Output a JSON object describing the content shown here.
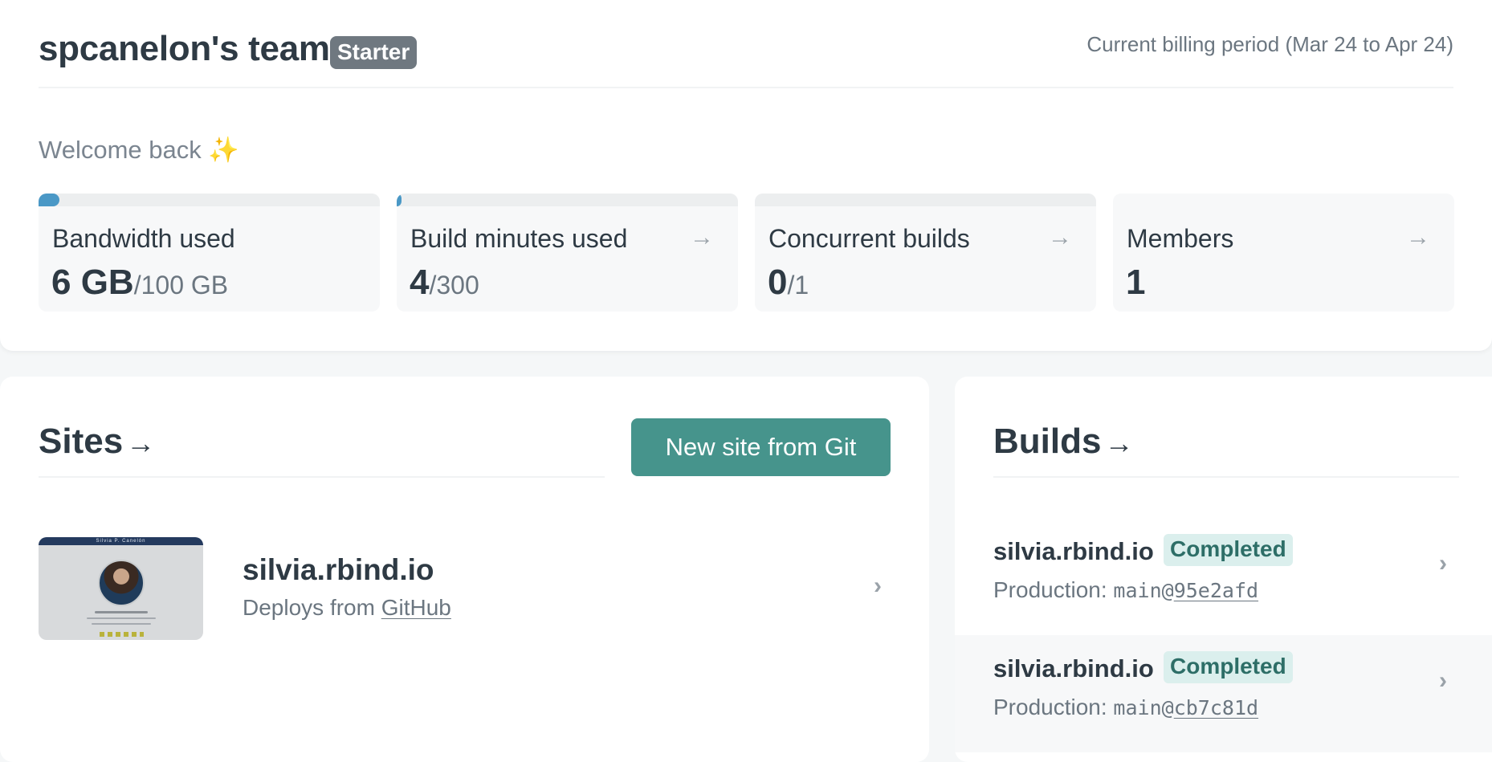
{
  "team": {
    "name": "spcanelon's team",
    "plan": "Starter",
    "billing_period": "Current billing period (Mar 24 to Apr 24)"
  },
  "welcome": {
    "text": "Welcome back",
    "emoji": "✨"
  },
  "stats": [
    {
      "label": "Bandwidth used",
      "value": "6 GB",
      "limit": "/100 GB",
      "progress_fraction": 0.06,
      "has_arrow": false
    },
    {
      "label": "Build minutes used",
      "value": "4",
      "limit": "/300",
      "progress_fraction": 0.013,
      "has_arrow": true
    },
    {
      "label": "Concurrent builds",
      "value": "0",
      "limit": "/1",
      "progress_fraction": 0.0,
      "has_arrow": true
    },
    {
      "label": "Members",
      "value": "1",
      "limit": "",
      "progress_fraction": null,
      "has_arrow": true
    }
  ],
  "arrow_glyph": "→",
  "sites": {
    "title": "Sites",
    "title_arrow": "→",
    "new_button": "New site from Git",
    "items": [
      {
        "name": "silvia.rbind.io",
        "deploys_prefix": "Deploys from",
        "deploys_source": "GitHub",
        "thumbnail_name": "Silvia P. Canelón"
      }
    ]
  },
  "builds": {
    "title": "Builds",
    "title_arrow": "→",
    "items": [
      {
        "site": "silvia.rbind.io",
        "status": "Completed",
        "context": "Production:",
        "branch": "main@",
        "commit": "95e2afd"
      },
      {
        "site": "silvia.rbind.io",
        "status": "Completed",
        "context": "Production:",
        "branch": "main@",
        "commit": "cb7c81d"
      }
    ]
  },
  "chevron_glyph": "›",
  "colors": {
    "accent": "#46948c",
    "progress": "#4a98c6",
    "status_bg": "#dbefed",
    "status_text": "#2d6e67",
    "plan_badge": "#6f7880"
  }
}
